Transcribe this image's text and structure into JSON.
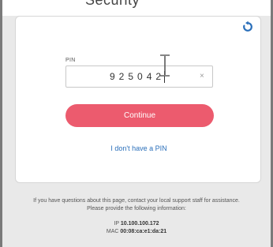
{
  "header": {
    "clipped_text": "Security"
  },
  "card": {
    "pin_label": "PIN",
    "pin_value": "925042",
    "clear_symbol": "×",
    "continue_label": "Continue",
    "no_pin_link": "I don't have a PIN",
    "icons": {
      "refresh": "refresh-icon",
      "cursor": "text-cursor-icon"
    }
  },
  "footer": {
    "line1": "If you have questions about this page, contact your local support staff for assistance.",
    "line2": "Please provide the following information:",
    "ip_label": "IP",
    "ip_value": "10.100.100.172",
    "mac_label": "MAC",
    "mac_value": "00:08:ca:e1:da:21"
  },
  "colors": {
    "accent": "#ec5b6e",
    "link": "#2a6fba",
    "icon_blue": "#2a6fba",
    "background": "#e9e9e9"
  }
}
